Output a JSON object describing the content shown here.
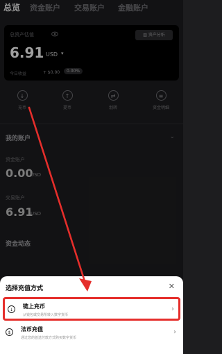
{
  "tabs": [
    "总览",
    "资金账户",
    "交易账户",
    "金融账户"
  ],
  "asset_card": {
    "label": "总资产估值",
    "analysis_button": "资产分析",
    "balance": "6.91",
    "unit": "USD",
    "pnl_label": "今日收益",
    "pnl_value": "+ $0.00",
    "pnl_percent": "0.00%"
  },
  "actions": [
    {
      "label": "充币",
      "icon": "download-icon"
    },
    {
      "label": "提币",
      "icon": "upload-icon"
    },
    {
      "label": "划转",
      "icon": "transfer-icon"
    },
    {
      "label": "资金明细",
      "icon": "list-icon"
    }
  ],
  "my_accounts": {
    "title": "我的账户",
    "accounts": [
      {
        "label": "资金账户",
        "value": "0.00",
        "unit": "USD"
      },
      {
        "label": "交易账户",
        "value": "6.91",
        "unit": "USD"
      }
    ]
  },
  "fund_activity": {
    "title": "资金动态"
  },
  "sheet": {
    "title": "选择充值方式",
    "methods": [
      {
        "title": "链上充币",
        "desc": "从钱包或交易所转入数字货币",
        "icon": "download-icon"
      },
      {
        "title": "法币充值",
        "desc": "通过您的首选付款方式购买数字货币",
        "icon": "dollar-icon"
      }
    ]
  },
  "colors": {
    "highlight": "#e52e2b",
    "background": "#1d1d1f",
    "sheet": "#ffffff"
  }
}
